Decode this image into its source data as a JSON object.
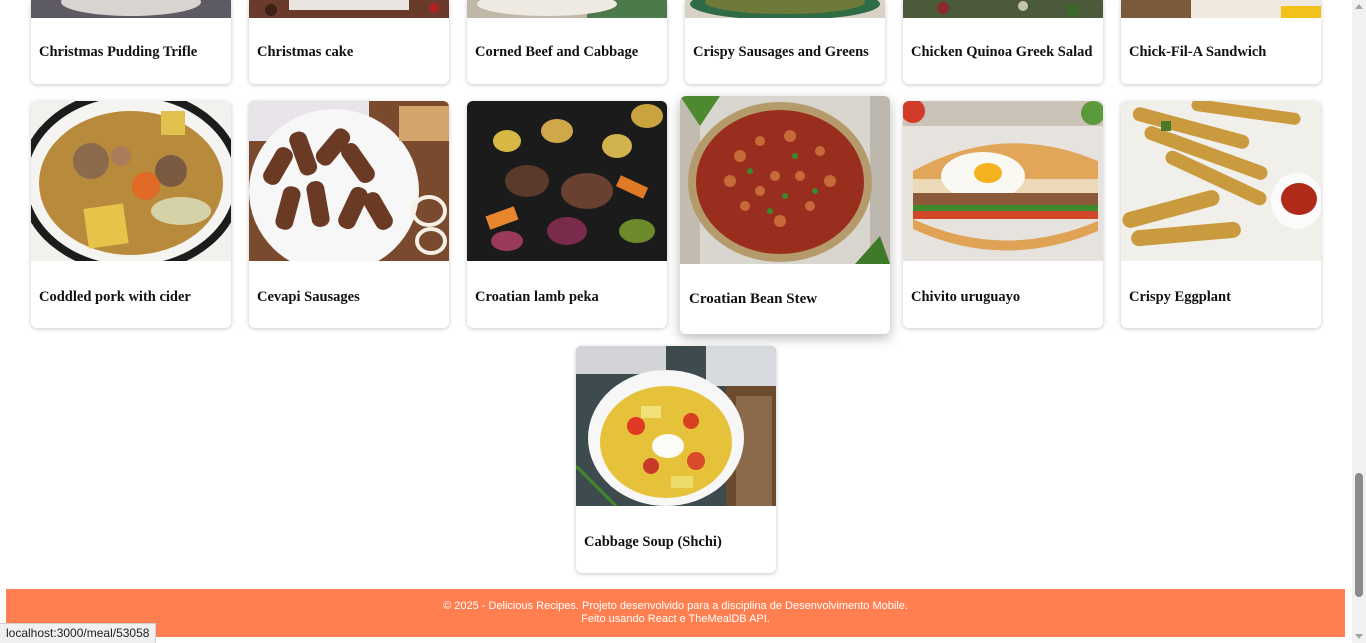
{
  "meals_top": [
    {
      "name": "Christmas Pudding Trifle"
    },
    {
      "name": "Christmas cake"
    },
    {
      "name": "Corned Beef and Cabbage"
    },
    {
      "name": "Crispy Sausages and Greens"
    },
    {
      "name": "Chicken Quinoa Greek Salad"
    },
    {
      "name": "Chick-Fil-A Sandwich"
    }
  ],
  "meals_middle": [
    {
      "name": "Coddled pork with cider"
    },
    {
      "name": "Cevapi Sausages"
    },
    {
      "name": "Croatian lamb peka"
    },
    {
      "name": "Croatian Bean Stew"
    },
    {
      "name": "Chivito uruguayo"
    },
    {
      "name": "Crispy Eggplant"
    }
  ],
  "meals_bottom": [
    {
      "name": "Cabbage Soup (Shchi)"
    }
  ],
  "footer": {
    "line1": "© 2025 - Delicious Recipes. Projeto desenvolvido para a disciplina de Desenvolvimento Mobile.",
    "line2": "Feito usando React e TheMealDB API."
  },
  "status_bar": {
    "url": "localhost:3000/meal/53058"
  },
  "colors": {
    "footer_bg": "#ff7f50",
    "page_bg": "#ffffff",
    "scroll_thumb": "#8b8b8b"
  }
}
